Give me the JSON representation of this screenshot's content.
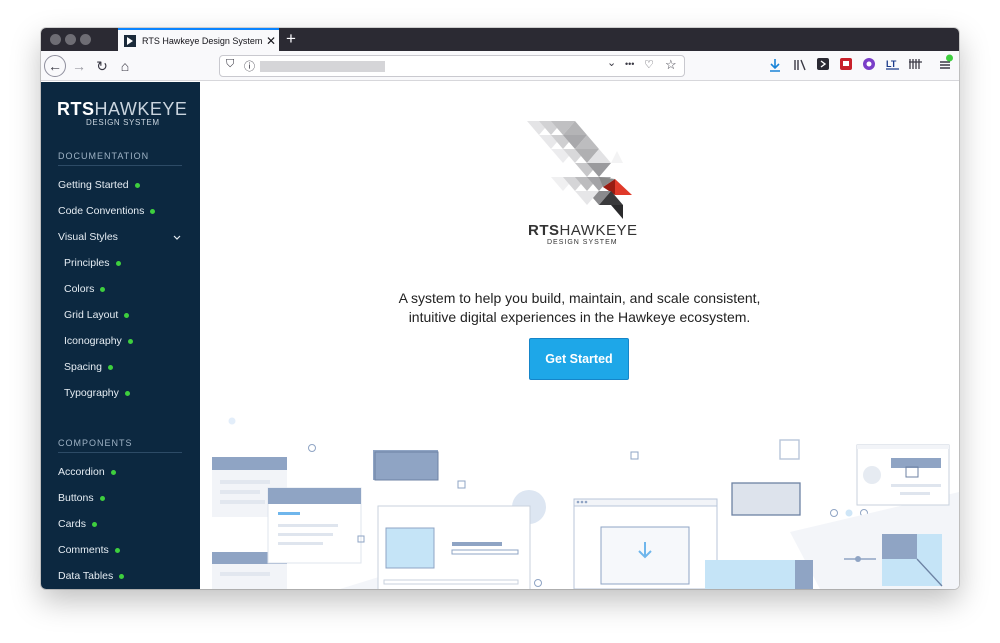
{
  "browser": {
    "tab_title": "RTS Hawkeye Design System | Ha",
    "tab_close": "✕",
    "new_tab": "+",
    "nav": {
      "back": "←",
      "forward": "→",
      "reload": "↻",
      "home": "⌂"
    },
    "url_icons": {
      "shield": "⛉",
      "info": "ⓘ",
      "dropdown": "⌄",
      "more": "•••",
      "pocket": "♡",
      "star": "☆"
    },
    "toolbar_icons": [
      "download-icon",
      "library-icon",
      "extension-icon",
      "extension-red-icon",
      "extension-purple-icon",
      "extension-lt-icon",
      "extension-bars-icon",
      "menu-icon"
    ]
  },
  "sidebar": {
    "logo_bold": "RTS",
    "logo_light": "HAWKEYE",
    "logo_sub": "DESIGN SYSTEM",
    "documentation_header": "DOCUMENTATION",
    "doc_items": [
      {
        "label": "Getting Started"
      },
      {
        "label": "Code Conventions"
      },
      {
        "label": "Visual Styles"
      },
      {
        "label": "Principles"
      },
      {
        "label": "Colors"
      },
      {
        "label": "Grid Layout"
      },
      {
        "label": "Iconography"
      },
      {
        "label": "Spacing"
      },
      {
        "label": "Typography"
      }
    ],
    "components_header": "COMPONENTS",
    "component_items": [
      {
        "label": "Accordion"
      },
      {
        "label": "Buttons"
      },
      {
        "label": "Cards"
      },
      {
        "label": "Comments"
      },
      {
        "label": "Data Tables"
      }
    ]
  },
  "main": {
    "brand_bold": "RTS",
    "brand_light": "HAWKEYE",
    "brand_sub": "DESIGN SYSTEM",
    "tagline_line1": "A system to help you build, maintain, and scale consistent,",
    "tagline_line2": "intuitive digital experiences in the Hawkeye ecosystem.",
    "cta_label": "Get Started"
  },
  "colors": {
    "sidebar_bg": "#0c2840",
    "status_dot": "#3ecf3e",
    "cta": "#1ea7e8",
    "illustration_blue": "#8fa4c4",
    "illustration_light_blue": "#c5e4f7"
  }
}
